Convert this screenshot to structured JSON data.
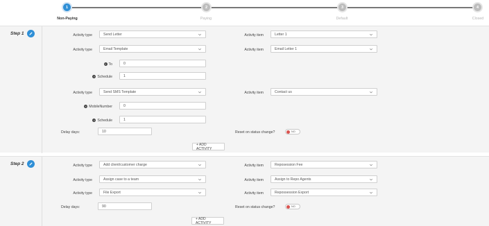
{
  "stepper": {
    "steps": [
      {
        "number": "1",
        "label": "Non-Paying",
        "active": true
      },
      {
        "number": "2",
        "label": "Paying",
        "active": false
      },
      {
        "number": "3",
        "label": "Default",
        "active": false
      },
      {
        "number": "4",
        "label": "Closed",
        "active": false
      }
    ]
  },
  "step1": {
    "title": "Step 1",
    "r1": {
      "type_label": "Activity type",
      "type_value": "Send Letter",
      "item_label": "Activity item",
      "item_value": "Letter 1"
    },
    "r2": {
      "type_label": "Activity type",
      "type_value": "Email Template",
      "item_label": "Activity item",
      "item_value": "Email Letter 1"
    },
    "to": {
      "label": "To",
      "value": "0"
    },
    "schedule1": {
      "label": "Schedule",
      "value": "1"
    },
    "r3": {
      "type_label": "Activity type",
      "type_value": "Send SMS Template",
      "item_label": "Activity item",
      "item_value": "Contact us"
    },
    "mobile": {
      "label": "MobileNumber",
      "value": "0"
    },
    "schedule2": {
      "label": "Schedule",
      "value": "1"
    },
    "delay": {
      "label": "Delay days:",
      "value": "10"
    },
    "reset": {
      "label": "Reset on status change?",
      "toggle": "NO"
    },
    "add_label": "+ ADD ACTIVITY"
  },
  "step2": {
    "title": "Step 2",
    "r1": {
      "type_label": "Activity type",
      "type_value": "Add client/customer charge",
      "item_label": "Activity item",
      "item_value": "Reposession Fee"
    },
    "r2": {
      "type_label": "Activity type",
      "type_value": "Assign case to a team",
      "item_label": "Activity item",
      "item_value": "Assign to Repo Agents"
    },
    "r3": {
      "type_label": "Activity type",
      "type_value": "File Export",
      "item_label": "Activity item",
      "item_value": "Repossession Export"
    },
    "delay": {
      "label": "Delay days:",
      "value": "90"
    },
    "reset": {
      "label": "Reset on status change?",
      "toggle": "NO"
    },
    "add_label": "+ ADD ACTIVITY"
  },
  "colors": {
    "accent": "#2f8fd6",
    "inactive": "#bdbdbd",
    "panel": "#f4f4f4",
    "toggle_off": "#d9534f"
  },
  "icons": {
    "edit": "pencil-icon",
    "select": "chevron-down-icon",
    "expand": "plus-circle-icon"
  }
}
